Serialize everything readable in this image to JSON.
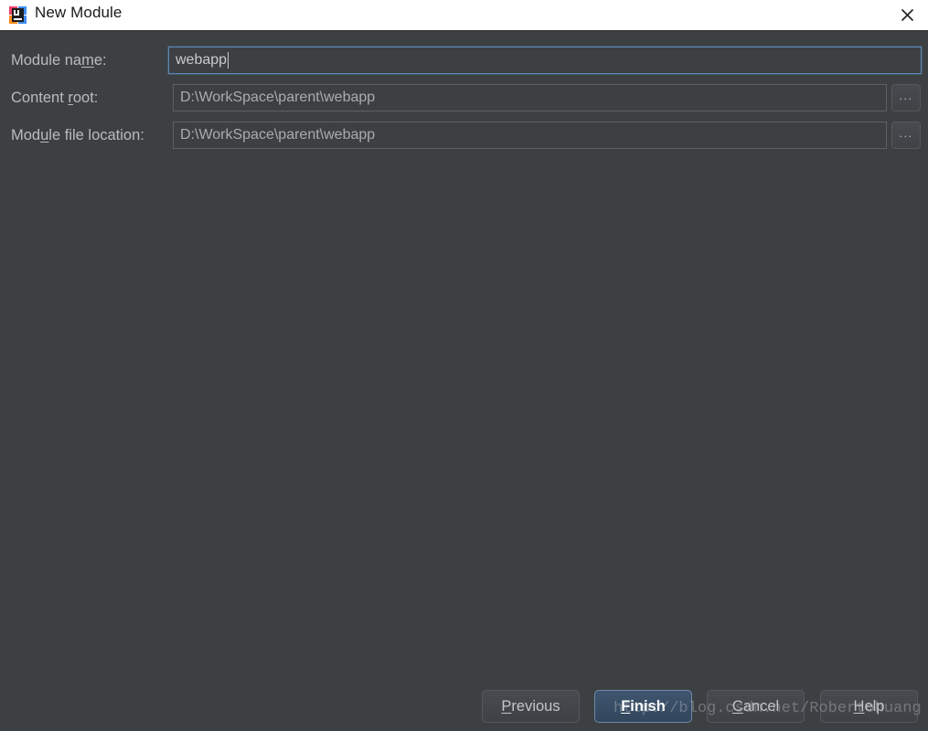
{
  "window": {
    "title": "New Module",
    "icon": "intellij-idea-icon",
    "close_label": "✕",
    "background_color": "#3c4043",
    "titlebar_color": "#ffffff"
  },
  "form": {
    "fields": [
      {
        "label_before": "Module na",
        "label_mnemonic": "m",
        "label_after": "e:",
        "value": "webapp",
        "focused": true,
        "has_browse": false
      },
      {
        "label_before": "Content ",
        "label_mnemonic": "r",
        "label_after": "oot:",
        "value": "D:\\WorkSpace\\parent\\webapp",
        "focused": false,
        "has_browse": true,
        "browse_label": "..."
      },
      {
        "label_before": "Mod",
        "label_mnemonic": "u",
        "label_after": "le file location:",
        "value": "D:\\WorkSpace\\parent\\webapp",
        "focused": false,
        "has_browse": true,
        "browse_label": "..."
      }
    ]
  },
  "buttons": {
    "previous": {
      "before": "",
      "mnemonic": "P",
      "after": "revious"
    },
    "finish": {
      "before": "",
      "mnemonic": "F",
      "after": "inish"
    },
    "cancel": {
      "before": "",
      "mnemonic": "C",
      "after": "ancel"
    },
    "help": {
      "before": "",
      "mnemonic": "H",
      "after": "elp"
    }
  },
  "watermark": {
    "text": "http://blog.csdn.net/Robertohuang"
  },
  "colors": {
    "accent_focus": "#5b87b5",
    "default_button": "#3f556f",
    "field_border": "#5c6164",
    "label_text": "#b9bcbf"
  }
}
